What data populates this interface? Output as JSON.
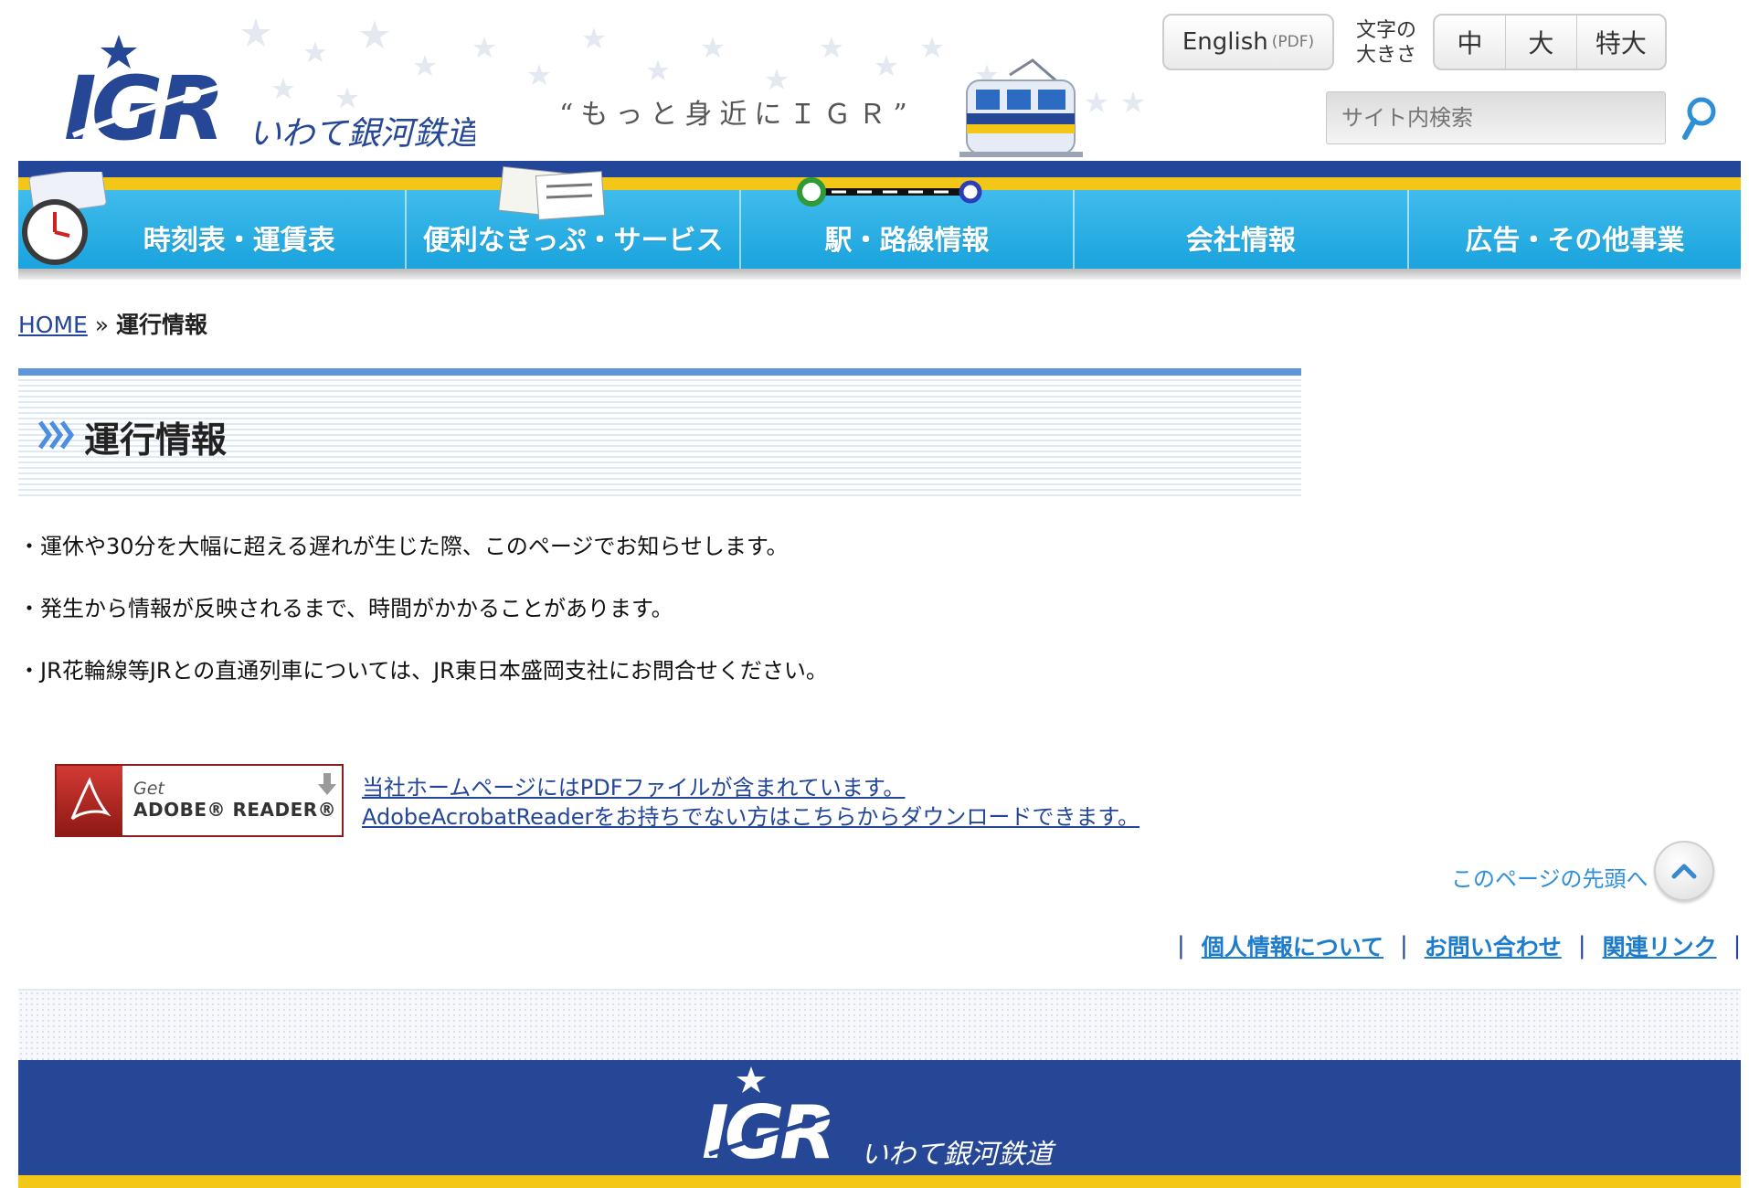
{
  "header": {
    "logo_text": "いわて銀河鉄道",
    "logo_mark": "IGR",
    "tagline": "“もっと身近にＩＧＲ”",
    "english_label": "English",
    "english_suffix": "(PDF)",
    "fontsize_label_1": "文字の",
    "fontsize_label_2": "大きさ",
    "fontsize_options": [
      "中",
      "大",
      "特大"
    ],
    "search_placeholder": "サイト内検索"
  },
  "nav": {
    "items": [
      {
        "label": "時刻表・運賃表"
      },
      {
        "label": "便利なきっぷ・サービス"
      },
      {
        "label": "駅・路線情報"
      },
      {
        "label": "会社情報"
      },
      {
        "label": "広告・その他事業"
      }
    ]
  },
  "breadcrumb": {
    "home": "HOME",
    "separator": "»",
    "current": "運行情報"
  },
  "page": {
    "title": "運行情報",
    "notices": [
      "・運休や30分を大幅に超える遅れが生じた際、このページでお知らせします。",
      "・発生から情報が反映されるまで、時間がかかることがあります。",
      "・JR花輪線等JRとの直通列車については、JR東日本盛岡支社にお問合せください。"
    ]
  },
  "adobe": {
    "get": "Get",
    "reader": "ADOBE® READER®",
    "link_line_1": "当社ホームページにはPDFファイルが含まれています。",
    "link_line_2": "AdobeAcrobatReaderをお持ちでない方はこちらからダウンロードできます。"
  },
  "pagetop": {
    "label": "このページの先頭へ"
  },
  "footer": {
    "links": [
      "個人情報について",
      "お問い合わせ",
      "関連リンク"
    ],
    "separator": "|",
    "logo_text": "いわて銀河鉄道",
    "logo_mark": "IGR"
  },
  "colors": {
    "brand_blue": "#23469b",
    "nav_cyan": "#1aa3dd",
    "brand_yellow": "#f3c717",
    "link_blue": "#1e7ccc"
  }
}
